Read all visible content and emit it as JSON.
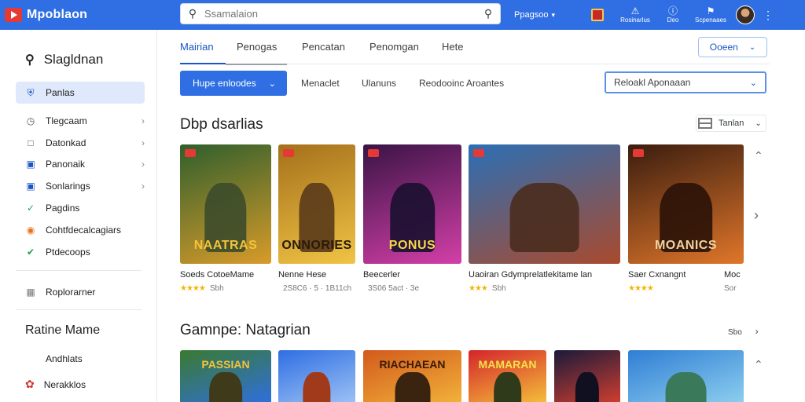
{
  "app": {
    "title": "Mpoblaon"
  },
  "search": {
    "placeholder": "Ssamalaion"
  },
  "topbar": {
    "link_label": "Ppagsoo",
    "icons": [
      {
        "name": "gift-icon",
        "label": ""
      },
      {
        "name": "badge-icon",
        "label": "Rosinarlus"
      },
      {
        "name": "info-icon",
        "label": "Deo"
      },
      {
        "name": "bell-icon",
        "label": "Scpenaaes"
      }
    ]
  },
  "sidebar": {
    "search_label": "Slagldnan",
    "items": [
      {
        "label": "Panlas",
        "icon": "shield-icon",
        "active": true,
        "chevron": false
      },
      {
        "label": "Tlegcaam",
        "icon": "clock-icon",
        "active": false,
        "chevron": true
      },
      {
        "label": "Datonkad",
        "icon": "square-icon",
        "active": false,
        "chevron": true
      },
      {
        "label": "Panonaik",
        "icon": "folder-icon",
        "active": false,
        "chevron": true
      },
      {
        "label": "Sonlarings",
        "icon": "frame-icon",
        "active": false,
        "chevron": true
      },
      {
        "label": "Pagdins",
        "icon": "check-icon",
        "active": false,
        "chevron": false
      },
      {
        "label": "Cohtfdecalcagiars",
        "icon": "target-icon",
        "active": false,
        "chevron": false
      },
      {
        "label": "Ptdecoops",
        "icon": "check-circle-icon",
        "active": false,
        "chevron": false
      }
    ],
    "extra_item": {
      "label": "Roplorarner",
      "icon": "grid-icon"
    },
    "section_heading": "Ratine Mame",
    "sub_items": [
      {
        "label": "Andhlats"
      },
      {
        "label": "Nerakklos"
      }
    ]
  },
  "tabs": [
    {
      "label": "Mairian",
      "active": true
    },
    {
      "label": "Penogas",
      "active": false
    },
    {
      "label": "Pencatan",
      "active": false
    },
    {
      "label": "Penomgan",
      "active": false
    },
    {
      "label": "Hete",
      "active": false
    }
  ],
  "open_button": {
    "label": "Ooeen"
  },
  "filters": {
    "primary": "Hupe enloodes",
    "links": [
      "Menaclet",
      "Ulanuns",
      "Reodooinc Aroantes"
    ],
    "select": "Reloakl Aponaaan"
  },
  "section1": {
    "title": "Dbp dsarlias",
    "view_label": "Tanlan",
    "games": [
      {
        "cover_title": "NAATRAS",
        "name": "Soeds CotoeMame",
        "rating": "★★★★",
        "meta": "Sbh",
        "colors": [
          "#2f5f2c",
          "#d89b2a"
        ],
        "hero": "#3c4b2a",
        "title_color": "#f5c33b"
      },
      {
        "cover_title": "ONNORIES",
        "name": "Nenne Hese",
        "rating": "",
        "meta": "2S8C6 · 5 · 1B11ch",
        "colors": [
          "#a5701b",
          "#f0c445"
        ],
        "hero": "#5a3a1a",
        "title_color": "#2a1a0a"
      },
      {
        "cover_title": "PONUS",
        "name": "Beecerler",
        "rating": "",
        "meta": "3S06 5act · 3e",
        "colors": [
          "#3a1446",
          "#d43fa8"
        ],
        "hero": "#1a1030",
        "title_color": "#f5d64a"
      },
      {
        "cover_title": "",
        "name": "Uaoiran Gdymprelatlekitame lan",
        "rating": "★★★",
        "meta": "Sbh",
        "colors": [
          "#2b6fb5",
          "#a94a2d"
        ],
        "hero": "#4a2c1e",
        "title_color": "#ffffff"
      },
      {
        "cover_title": "MOANICS",
        "name": "Saer Cxnangnt",
        "rating": "★★★★",
        "meta": "",
        "colors": [
          "#3a1d0f",
          "#e0762a"
        ],
        "hero": "#2a1208",
        "title_color": "#f0d4a0"
      }
    ],
    "overflow_name": "Moc",
    "overflow_meta": "Sor"
  },
  "section2": {
    "title": "Gamnpe: Natagrian",
    "more_label": "Sbo",
    "games": [
      {
        "cover_title": "PASSIAN",
        "colors": [
          "#3a7a2f",
          "#2f6fe3"
        ],
        "hero": "#3f3a1a",
        "title_color": "#f4c33b"
      },
      {
        "cover_title": "",
        "colors": [
          "#2f6fe3",
          "#9fc3f5"
        ],
        "hero": "#a03a1a",
        "title_color": "#ffffff"
      },
      {
        "cover_title": "RIACHAEAN",
        "colors": [
          "#d25a1c",
          "#f3b43a"
        ],
        "hero": "#3a2410",
        "title_color": "#3a1a08"
      },
      {
        "cover_title": "MAMARAN",
        "colors": [
          "#d4242a",
          "#f5c33b"
        ],
        "hero": "#2f3a1a",
        "title_color": "#f5e04a"
      },
      {
        "cover_title": "",
        "colors": [
          "#1a1a3a",
          "#d43f2f"
        ],
        "hero": "#101020",
        "title_color": "#ffffff"
      },
      {
        "cover_title": "",
        "colors": [
          "#2f7ed4",
          "#8fd0f0"
        ],
        "hero": "#3a7a5a",
        "title_color": "#ffffff"
      }
    ]
  },
  "colors": {
    "brand": "#2f6fe3",
    "accent": "#1a56c4",
    "star": "#f5b400"
  }
}
